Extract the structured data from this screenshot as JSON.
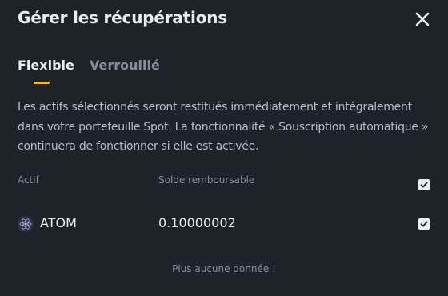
{
  "modal": {
    "title": "Gérer les récupérations",
    "close_icon": "close-icon"
  },
  "tabs": [
    {
      "label": "Flexible",
      "active": true
    },
    {
      "label": "Verrouillé",
      "active": false
    }
  ],
  "description": "Les actifs sélectionnés seront restitués immédiatement et intégralement dans votre portefeuille Spot. La fonctionnalité « Souscription automatique » continuera de fonctionner si elle est activée.",
  "table": {
    "headers": {
      "asset": "Actif",
      "balance": "Solde remboursable"
    },
    "select_all_checked": true,
    "rows": [
      {
        "asset": "ATOM",
        "icon": "atom-coin-icon",
        "balance": "0.10000002",
        "checked": true
      }
    ],
    "empty_message": "Plus aucune donnée !"
  },
  "colors": {
    "background": "#1e2329",
    "accent": "#f0b90b",
    "text_primary": "#eaecef",
    "text_secondary": "#848e9c"
  }
}
